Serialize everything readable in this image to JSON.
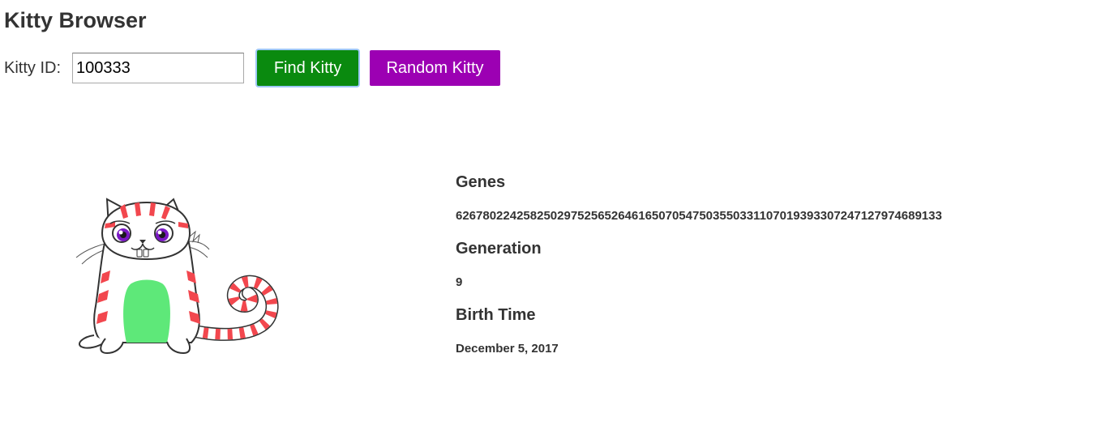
{
  "app": {
    "title": "Kitty Browser"
  },
  "search": {
    "label": "Kitty ID:",
    "value": "100333",
    "find_button": "Find Kitty",
    "random_button": "Random Kitty"
  },
  "kitty": {
    "image_icon": "cartoon-cat-image",
    "genes_label": "Genes",
    "genes_value": "626780224258250297525652646165070547503550331107019393307247127974689133",
    "generation_label": "Generation",
    "generation_value": "9",
    "birth_time_label": "Birth Time",
    "birth_time_value": "December 5, 2017"
  },
  "colors": {
    "find_button": "#0a8a0f",
    "random_button": "#9c00b3",
    "stripe": "#f2474e",
    "belly": "#5ee879",
    "eye": "#7a18c4"
  }
}
